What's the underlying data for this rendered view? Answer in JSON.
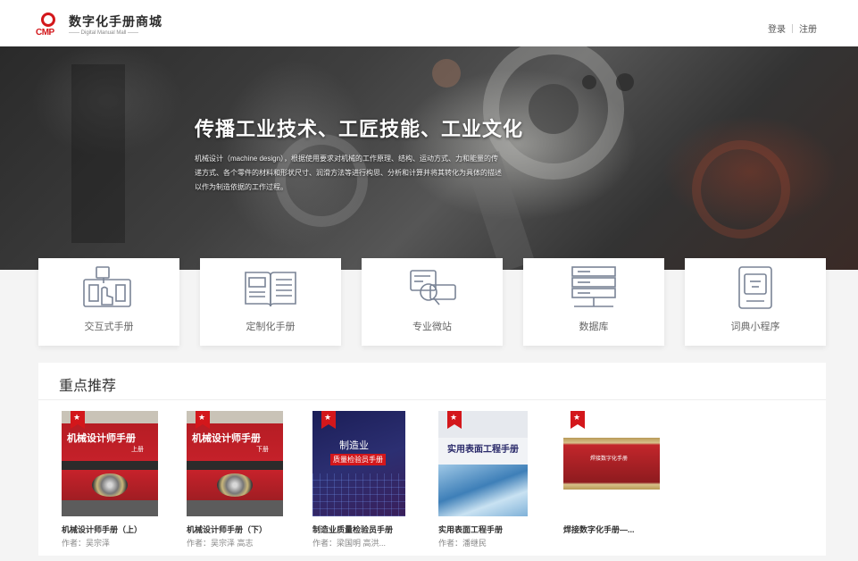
{
  "header": {
    "logo_mark_text": "CMP",
    "logo_title": "数字化手册商城",
    "logo_subtitle": "—— Digital Manual Mall ——",
    "login_label": "登录",
    "register_label": "注册"
  },
  "hero": {
    "title": "传播工业技术、工匠技能、工业文化",
    "description": "机械设计（machine design），根据使用要求对机械的工作原理、结构、运动方式、力和能量的传递方式、各个零件的材料和形状尺寸、润滑方法等进行构思、分析和计算并将其转化为具体的描述以作为制造依据的工作过程。"
  },
  "features": [
    {
      "label": "交互式手册",
      "icon": "interactive-manual-icon"
    },
    {
      "label": "定制化手册",
      "icon": "open-book-icon"
    },
    {
      "label": "专业微站",
      "icon": "micro-site-icon"
    },
    {
      "label": "数据库",
      "icon": "database-server-icon"
    },
    {
      "label": "词典小程序",
      "icon": "dictionary-icon"
    }
  ],
  "recommend": {
    "title": "重点推荐",
    "books": [
      {
        "name": "机械设计师手册（上）",
        "author": "作者：吴宗泽",
        "cover_title": "机械设计师手册",
        "cover_volume": "上册"
      },
      {
        "name": "机械设计师手册（下）",
        "author": "作者：吴宗泽 高志",
        "cover_title": "机械设计师手册",
        "cover_volume": "下册"
      },
      {
        "name": "制造业质量检验员手册",
        "author": "作者：梁国明 高洪...",
        "cover_title": "制造业",
        "cover_subtitle": "质量检验员手册"
      },
      {
        "name": "实用表面工程手册",
        "author": "作者：潘继民",
        "cover_title": "实用表面工程手册"
      },
      {
        "name": "焊接数字化手册—...",
        "author": "",
        "cover_title": "焊接数字化手册"
      }
    ]
  },
  "colors": {
    "brand_red": "#d3171b",
    "page_bg": "#f4f4f4"
  }
}
